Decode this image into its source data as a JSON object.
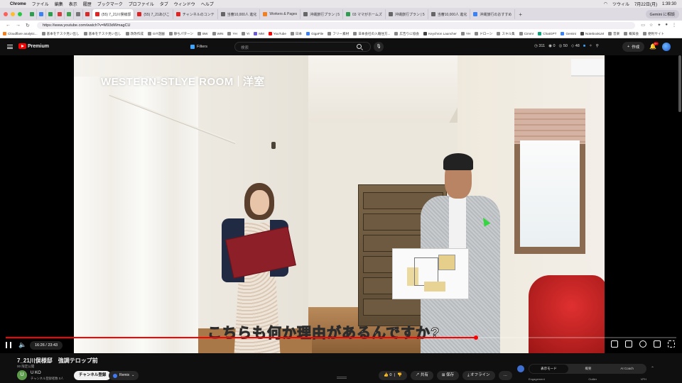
{
  "menubar": {
    "apple": "",
    "app": "Chrome",
    "items": [
      "ファイル",
      "編集",
      "表示",
      "履歴",
      "ブックマーク",
      "プロファイル",
      "タブ",
      "ウィンドウ",
      "ヘルプ"
    ],
    "right_items": [
      "ツウィル",
      "7月22日(月)",
      "1:39:30"
    ]
  },
  "tabs": [
    {
      "label": "",
      "color": "#2e9e4e",
      "active": false
    },
    {
      "label": "",
      "color": "#3b82f6",
      "active": false
    },
    {
      "label": "",
      "color": "#2e9e4e",
      "active": false
    },
    {
      "label": "",
      "color": "#d83b3b",
      "active": false
    },
    {
      "label": "",
      "color": "#3ea04a",
      "active": false
    },
    {
      "label": "",
      "color": "#777777",
      "active": false
    },
    {
      "label": "",
      "color": "#d62929",
      "active": false
    },
    {
      "label": "(55) 7_21川俣様邸",
      "color": "#e02323",
      "active": true
    },
    {
      "label": "(55) 7_21あびこ",
      "color": "#e02323",
      "active": false
    },
    {
      "label": "チャンネルのコンテ",
      "color": "#e02323",
      "active": false
    },
    {
      "label": "当審10,000人 進化",
      "color": "#666666",
      "active": false
    },
    {
      "label": "Workers & Pages",
      "color": "#f38020",
      "active": false
    },
    {
      "label": "沖縄旅行プラン | 5",
      "color": "#666666",
      "active": false
    },
    {
      "label": "03 ママがホームズ",
      "color": "#2e9e4e",
      "active": false
    },
    {
      "label": "沖縄旅行プラン | 5",
      "color": "#666666",
      "active": false
    },
    {
      "label": "当審10,000人 進化",
      "color": "#666666",
      "active": false
    },
    {
      "label": "沖縄旅行のおすすめ",
      "color": "#3b82f6",
      "active": false
    }
  ],
  "gemini_button": "Gemini に相談",
  "address": {
    "url": "https://www.youtube.com/watch?v=M93dWmagCU"
  },
  "bookmarks": [
    "Cloudflare analytic...",
    "基本をテスク見い出し",
    "基本をテスク見い出し",
    "改改作成",
    "GIT遊園",
    "静ちパターン",
    "BW",
    "WIN",
    "YH",
    "YI",
    "MM",
    "YouTube",
    "日本",
    "GigaFile",
    "フリー素材",
    "日本会社の入籍住方...",
    "広告りに協会",
    "Keychron Launcher",
    "YH",
    "ドローン",
    "スキル集",
    "Cimmr",
    "ChatGPT",
    "Gemini",
    "NotebookLM",
    "音楽",
    "概知会",
    "便利サイト"
  ],
  "bookmark_colors": [
    "#f38020",
    "#888888",
    "#888888",
    "#888888",
    "#888888",
    "#888888",
    "#888888",
    "#888888",
    "#888888",
    "#888888",
    "#6b5bd6",
    "#ff0000",
    "#888888",
    "#3b82f6",
    "#888888",
    "#888888",
    "#888888",
    "#444444",
    "#888888",
    "#888888",
    "#888888",
    "#888888",
    "#10a37f",
    "#3b82f6",
    "#444444",
    "#888888",
    "#888888",
    "#888888"
  ],
  "yt_header": {
    "logo": "Premium",
    "filters": "Filters",
    "search_placeholder": "検索",
    "stats": [
      "311",
      "0",
      "50",
      "48"
    ],
    "create": "作成",
    "notif_badge": "9+"
  },
  "video": {
    "room_title_en": "WESTERN-STLYE ROOM",
    "room_title_jp": "洋室",
    "subtitle": "こちらも何か理由があるんですか?",
    "progress": 0.701,
    "time_text": "16:26 / 23:43"
  },
  "details": {
    "title": "7_21川俣様邸",
    "title_suffix": "強調テロップ前",
    "meta": "00 限定公開",
    "channel_initial": "U",
    "channel_name": "U KO",
    "subscribers": "チャンネル登録者数 0人",
    "subscribe": "チャンネル登録",
    "remix": "Remix",
    "like_count": "0",
    "dislike": "",
    "share": "共有",
    "save": "保存",
    "offline": "オフライン",
    "more": "…"
  },
  "side_panel": {
    "segments": [
      "表示モード",
      "概要",
      "AI Coach"
    ],
    "labels": [
      "Engagement",
      "Outlier",
      "VPH"
    ]
  }
}
